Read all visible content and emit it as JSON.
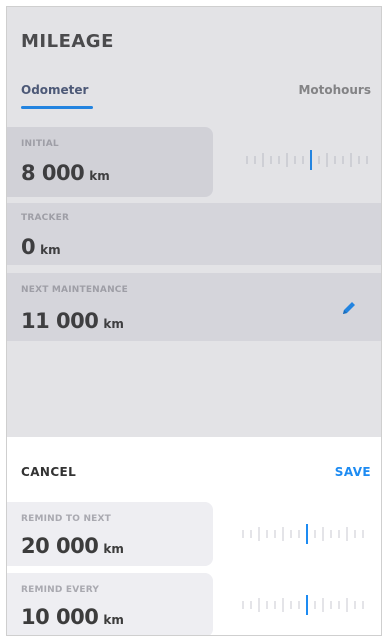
{
  "screen": {
    "title": "MILEAGE",
    "tabs": [
      {
        "label": "Odometer",
        "active": true
      },
      {
        "label": "Motohours",
        "active": false
      }
    ]
  },
  "fields": {
    "initial": {
      "label": "INITIAL",
      "value": "8 000",
      "unit": "km"
    },
    "tracker": {
      "label": "TRACKER",
      "value": "0",
      "unit": "km"
    },
    "next_maintenance": {
      "label": "NEXT MAINTENANCE",
      "value": "11 000",
      "unit": "km"
    }
  },
  "sheet": {
    "cancel_label": "CANCEL",
    "save_label": "SAVE",
    "remind_next": {
      "label": "REMIND TO NEXT",
      "value": "20 000",
      "unit": "km"
    },
    "remind_every": {
      "label": "REMIND EVERY",
      "value": "10 000",
      "unit": "km"
    }
  },
  "icons": {
    "edit": "pencil-icon",
    "ruler": "ruler-picker-icon"
  },
  "colors": {
    "accent": "#1d8bf2",
    "text_dark": "#3c3c3c",
    "label_gray": "#a9a9b0"
  }
}
